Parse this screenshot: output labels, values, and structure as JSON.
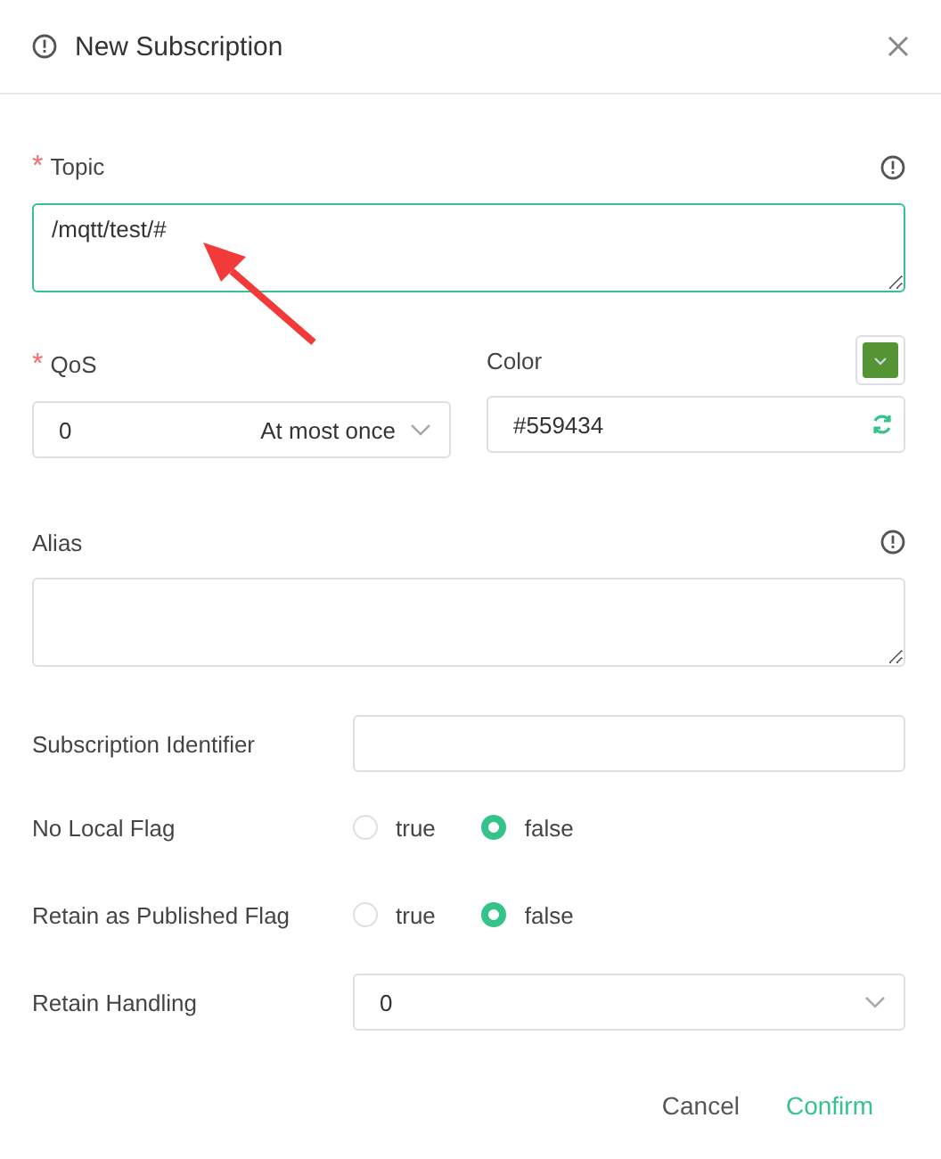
{
  "dialog": {
    "title": "New Subscription"
  },
  "topic": {
    "label": "Topic",
    "required_mark": "*",
    "value": "/mqtt/test/#",
    "focused": true
  },
  "qos": {
    "label": "QoS",
    "required_mark": "*",
    "value": "0",
    "description": "At most once"
  },
  "color": {
    "label": "Color",
    "value": "#559434"
  },
  "alias": {
    "label": "Alias"
  },
  "subscription_identifier": {
    "label": "Subscription Identifier"
  },
  "flags": [
    {
      "label": "No Local Flag",
      "options": [
        {
          "label": "true",
          "selected": false
        },
        {
          "label": "false",
          "selected": true
        }
      ]
    },
    {
      "label": "Retain as Published Flag",
      "options": [
        {
          "label": "true",
          "selected": false
        },
        {
          "label": "false",
          "selected": true
        }
      ]
    }
  ],
  "retain_handling": {
    "label": "Retain Handling",
    "value": "0"
  },
  "buttons": [
    {
      "label": "Cancel",
      "kind": "secondary"
    },
    {
      "label": "Confirm",
      "kind": "primary"
    }
  ]
}
